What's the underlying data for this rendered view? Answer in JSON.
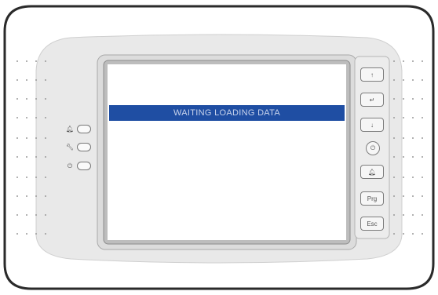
{
  "screen": {
    "status_text": "WAITING LOADING DATA"
  },
  "keys": [
    {
      "name": "up-key",
      "glyph": "↑"
    },
    {
      "name": "enter-key",
      "glyph": "↵"
    },
    {
      "name": "down-key",
      "glyph": "↓"
    },
    {
      "name": "power-key",
      "glyph": "⏻"
    },
    {
      "name": "alarm-key",
      "glyph": "🔔︎"
    },
    {
      "name": "prg-key",
      "glyph": "Prg"
    },
    {
      "name": "esc-key",
      "glyph": "Esc"
    }
  ],
  "leds": [
    {
      "name": "alarm-led-icon",
      "glyph": "🔔︎"
    },
    {
      "name": "service-led-icon",
      "glyph": "🔧︎"
    },
    {
      "name": "power-led-icon",
      "glyph": "⏻"
    }
  ],
  "colors": {
    "status_bar": "#1f4ea3",
    "status_text": "#c9d4ec",
    "bezel_outline": "#2a2a2a"
  }
}
